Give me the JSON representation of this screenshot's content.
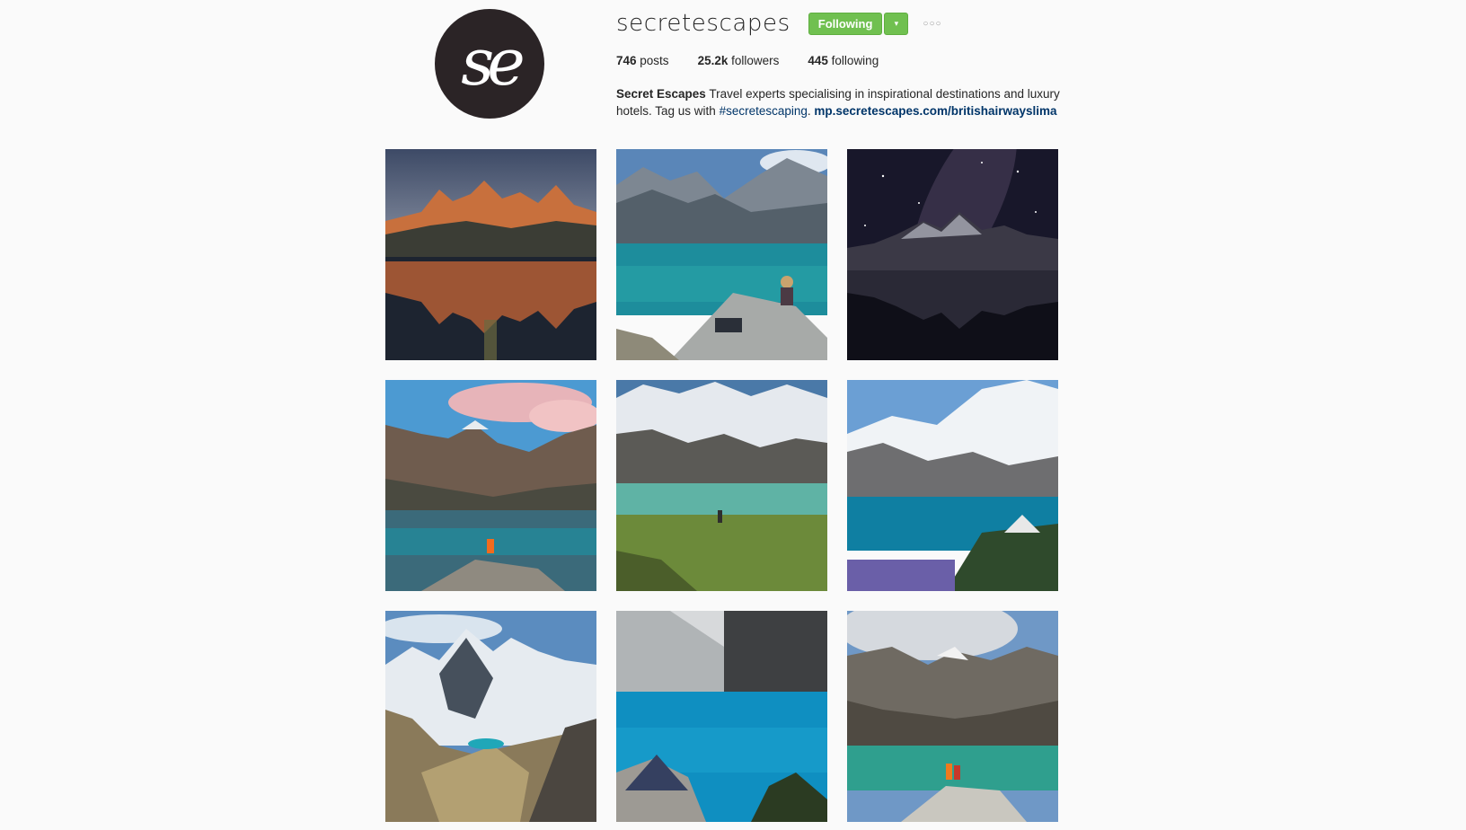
{
  "profile": {
    "username": "secretescapes",
    "avatar_text": "se",
    "follow_button_label": "Following",
    "dropdown_icon": "▾",
    "options_icon": "○○○",
    "stats": {
      "posts_count": "746",
      "posts_label": " posts",
      "followers_count": "25.2k",
      "followers_label": " followers",
      "following_count": "445",
      "following_label": " following"
    },
    "bio": {
      "name": "Secret Escapes",
      "text_1": " Travel experts specialising in inspirational destinations and luxury hotels. Tag us with ",
      "hashtag": "#secretescaping",
      "text_2": ". ",
      "link": "mp.secretescapes.com/britishairwayslima"
    }
  },
  "posts": [
    {
      "name": "sunset-peaks-reflection"
    },
    {
      "name": "hiker-on-rock-turquoise-lake"
    },
    {
      "name": "milky-way-over-mountains"
    },
    {
      "name": "pink-clouds-lake-hiker"
    },
    {
      "name": "glacier-green-valley-lake"
    },
    {
      "name": "tent-by-blue-lake-flowers"
    },
    {
      "name": "snowy-range-valley-lagoon"
    },
    {
      "name": "blue-lake-tent-cliffs"
    },
    {
      "name": "hikers-emerald-lake"
    }
  ],
  "colors": {
    "follow_green": "#70c050",
    "link_blue": "#003569",
    "avatar_bg": "#2b2426"
  }
}
